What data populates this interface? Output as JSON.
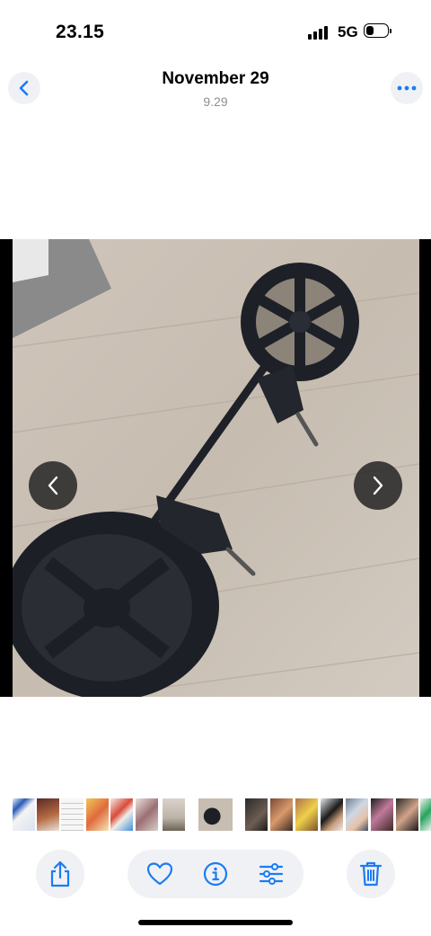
{
  "status_bar": {
    "time": "23.15",
    "network": "5G",
    "battery_level": 0.35,
    "signal_bars": 4
  },
  "header": {
    "title": "November 29",
    "subtitle": "9.29",
    "back_icon": "chevron-left-icon",
    "more_icon": "ellipsis-icon"
  },
  "photo": {
    "prev_icon": "chevron-left-icon",
    "next_icon": "chevron-right-icon"
  },
  "thumbnail_strip": {
    "count": 17
  },
  "toolbar": {
    "share_icon": "share-icon",
    "favorite_icon": "heart-icon",
    "info_icon": "info-icon",
    "adjust_icon": "sliders-icon",
    "delete_icon": "trash-icon"
  },
  "colors": {
    "accent": "#1a7cf5",
    "button_bg": "#f0f1f4",
    "subtitle": "#8e8e93"
  }
}
